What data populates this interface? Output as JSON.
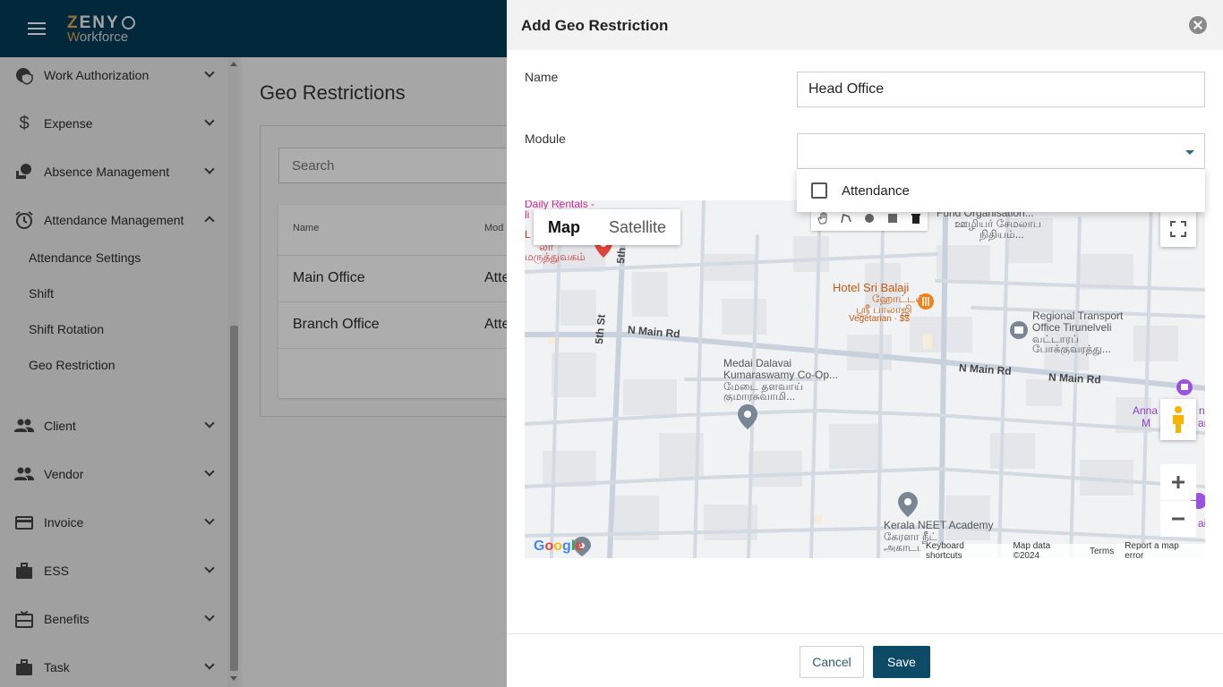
{
  "brand": {
    "line1": "ZENY",
    "line2_first": "W",
    "line2_rest": "orkforce"
  },
  "sidebar": {
    "items": [
      {
        "label": "Work Authorization"
      },
      {
        "label": "Expense"
      },
      {
        "label": "Absence Management"
      },
      {
        "label": "Attendance Management"
      },
      {
        "label": "Client"
      },
      {
        "label": "Vendor"
      },
      {
        "label": "Invoice"
      },
      {
        "label": "ESS"
      },
      {
        "label": "Benefits"
      },
      {
        "label": "Task"
      }
    ],
    "subitems": [
      {
        "label": "Attendance Settings"
      },
      {
        "label": "Shift"
      },
      {
        "label": "Shift Rotation"
      },
      {
        "label": "Geo Restriction"
      }
    ]
  },
  "main": {
    "title": "Geo Restrictions",
    "search_placeholder": "Search",
    "columns": [
      "Name",
      "Mod"
    ],
    "rows": [
      {
        "name": "Main Office",
        "module": "Atte"
      },
      {
        "name": "Branch Office",
        "module": "Atte"
      }
    ]
  },
  "dialog": {
    "title": "Add Geo Restriction",
    "name_label": "Name",
    "name_value": "Head Office",
    "module_label": "Module",
    "module_value": "",
    "module_options": [
      {
        "label": "Attendance",
        "checked": false
      }
    ],
    "cancel_label": "Cancel",
    "save_label": "Save"
  },
  "map": {
    "type_options": [
      "Map",
      "Satellite"
    ],
    "active_type": "Map",
    "labels": {
      "daily_rentals": "Daily Rentals -",
      "daily_rentals_2": "li",
      "daily_rentals_3": "L",
      "hospital_ta_1": "லா",
      "hospital_ta_2": "மருத்துவகம்",
      "fund_org": "Fund Organisation...",
      "fund_org_ta_1": "ஊழியர் சேமலாப",
      "fund_org_ta_2": "நிதியம்...",
      "hotel": "Hotel Sri Balaji",
      "hotel_ta": "ஹோட்டல்",
      "hotel_ta_2": "ஸ்ரீ பாலாஜி",
      "hotel_sub": "Vegetarian · $$",
      "rto_1": "Regional Transport",
      "rto_2": "Office Tirunelveli",
      "rto_ta_1": "வட்டாரப்",
      "rto_ta_2": "போக்குவரத்து...",
      "coop_1": "Medai Dalavai",
      "coop_2": "Kumaraswamy Co-Op...",
      "coop_ta_1": "மேடை தளவாய்",
      "coop_ta_2": "குமாரசுவாமி...",
      "anna": "Anna",
      "anna_2": "M",
      "anna_3": "n",
      "anna_4": "ar",
      "neet": "Kerala NEET Academy",
      "neet_ta_1": "கேரளா நீட்",
      "neet_ta_2": "அகாடமி",
      "cl": "C",
      "ai": "ai",
      "road_n_main_1": "N Main Rd",
      "road_n_main_2": "N Main Rd",
      "road_n_main_3": "N Main Rd",
      "road_5th_1": "5th St",
      "road_5th_2": "5th"
    },
    "google": "Google",
    "attribution": [
      "Keyboard shortcuts",
      "Map data ©2024",
      "Terms",
      "Report a map error"
    ]
  }
}
